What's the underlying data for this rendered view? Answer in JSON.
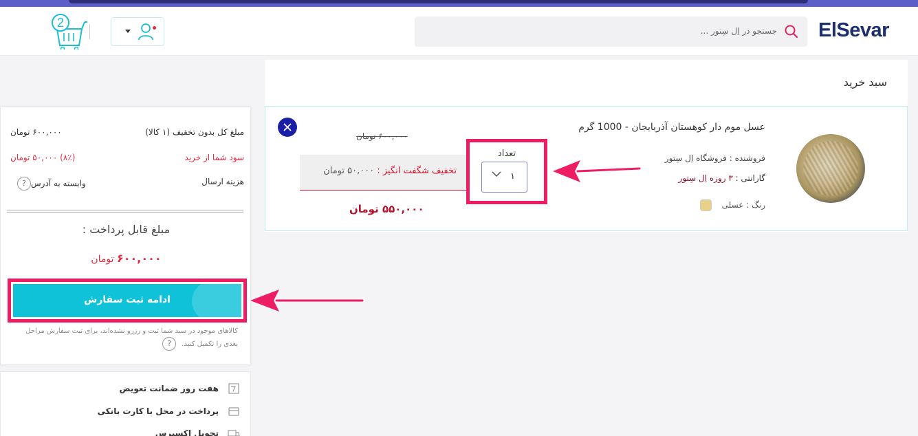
{
  "header": {
    "logo_text_a": "El",
    "logo_text_b": "Sevar",
    "search_placeholder": "جستجو در اِل سِتور ...",
    "cart_count": "2"
  },
  "cart": {
    "title": "سبد خرید",
    "item": {
      "name": "عسل موم دار کوهستان آذربایجان - 1000 گرم",
      "seller": "فروشنده : فروشگاه اِل سِتور",
      "warranty_label": "گارانتی :",
      "warranty_value": "۳ روزه اِل سِتور",
      "color_label": "رنگ :",
      "color_value": "عسلی",
      "color_hex": "#e8d189",
      "qty_label": "تعداد",
      "qty_value": "۱",
      "old_price": "۶۰۰,۰۰۰ تومان",
      "discount_label": "تخفیف شگفت انگیز :",
      "discount_amount": "۵۰,۰۰۰ تومان",
      "final_price": "۵۵۰,۰۰۰ تومان"
    }
  },
  "summary": {
    "total_label": "مبلغ کل بدون تخفیف (۱ کالا)",
    "total_value": "۶۰۰,۰۰۰ تومان",
    "profit_label": "سود شما از خرید",
    "profit_value": "(۸٪) ۵۰,۰۰۰ تومان",
    "shipping_label": "هزینه ارسال",
    "shipping_value": "وابسته به آدرس",
    "payable_label": "مبلغ قابل پرداخت :",
    "payable_amount": "۶۰۰,۰۰۰",
    "payable_unit": "تومان",
    "submit_label": "ادامه ثبت سفارش",
    "note": "کالاهای موجود در سبد شما ثبت و رزرو نشده‌اند، برای ثبت سفارش مراحل بعدی را تکمیل کنید.",
    "help_glyph": "?"
  },
  "features": [
    {
      "label": "هفت روز ضمانت تعویض"
    },
    {
      "label": "پرداخت در محل با کارت بانکی"
    },
    {
      "label": "تحویل اکسپرس"
    }
  ],
  "colors": {
    "accent": "#0fc2d8",
    "highlight": "#ee1d63",
    "price_red": "#e8293f",
    "brand_navy": "#1a2f6b"
  }
}
